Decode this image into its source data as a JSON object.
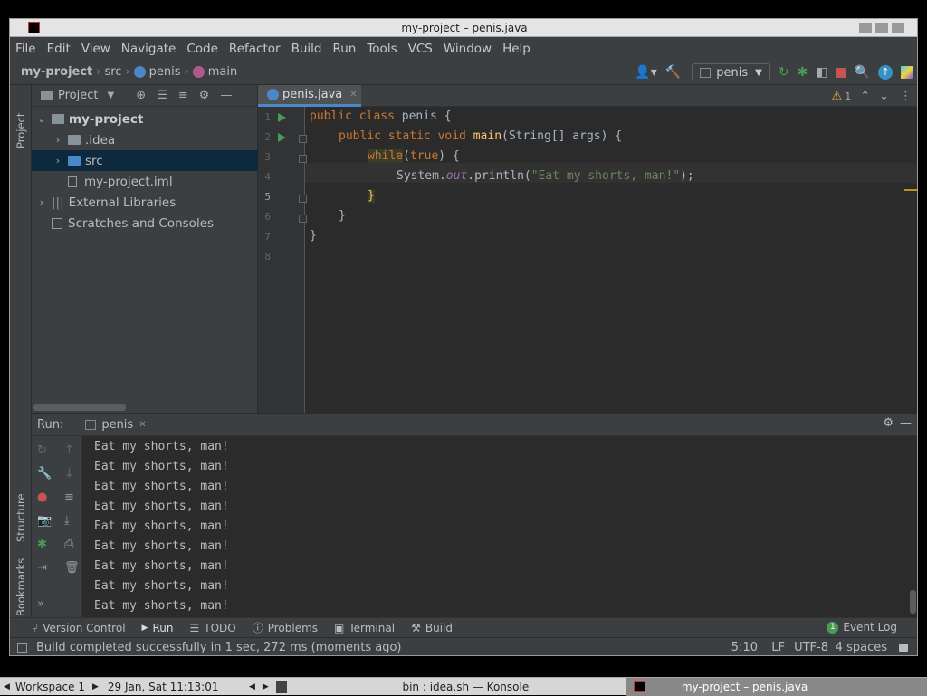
{
  "window": {
    "title": "my-project – penis.java"
  },
  "menu": [
    "File",
    "Edit",
    "View",
    "Navigate",
    "Code",
    "Refactor",
    "Build",
    "Run",
    "Tools",
    "VCS",
    "Window",
    "Help"
  ],
  "breadcrumb": {
    "project": "my-project",
    "src": "src",
    "class": "penis",
    "method": "main"
  },
  "toolbar": {
    "run_config": "penis"
  },
  "project_panel": {
    "title": "Project",
    "tree": {
      "root": "my-project",
      "idea": ".idea",
      "src": "src",
      "iml": "my-project.iml",
      "external": "External Libraries",
      "scratches": "Scratches and Consoles"
    }
  },
  "editor": {
    "tab": "penis.java",
    "warnings": "1",
    "lines": [
      "1",
      "2",
      "3",
      "4",
      "5",
      "6",
      "7",
      "8"
    ],
    "code": {
      "l1_kw": "public class ",
      "l1_name": "penis {",
      "l2_kw": "public static void ",
      "l2_fn": "main",
      "l2_rest": "(String[] args) {",
      "l3_kw": "while",
      "l3_p": "(",
      "l3_true": "true",
      "l3_rest": ") {",
      "l4_a": "System.",
      "l4_out": "out",
      "l4_b": ".println(",
      "l4_str": "\"Eat my shorts, man!\"",
      "l4_c": ");",
      "l5": "}",
      "l6": "}",
      "l7": "}"
    }
  },
  "run_panel": {
    "label": "Run:",
    "tab": "penis",
    "output": [
      "Eat my shorts, man!",
      "Eat my shorts, man!",
      "Eat my shorts, man!",
      "Eat my shorts, man!",
      "Eat my shorts, man!",
      "Eat my shorts, man!",
      "Eat my shorts, man!",
      "Eat my shorts, man!",
      "Eat my shorts, man!"
    ]
  },
  "side_labels": {
    "project": "Project",
    "structure": "Structure",
    "bookmarks": "Bookmarks"
  },
  "bottom_tabs": {
    "vcs": "Version Control",
    "run": "Run",
    "todo": "TODO",
    "problems": "Problems",
    "terminal": "Terminal",
    "build": "Build",
    "event_log": "Event Log",
    "event_count": "1"
  },
  "status": {
    "message": "Build completed successfully in 1 sec, 272 ms (moments ago)",
    "position": "5:10",
    "line_sep": "LF",
    "encoding": "UTF-8",
    "indent": "4 spaces"
  },
  "taskbar": {
    "workspace": "Workspace 1",
    "datetime": "29 Jan, Sat 11:13:01",
    "konsole": "bin : idea.sh — Konsole",
    "app": "my-project – penis.java"
  },
  "colors": {
    "keyword": "#cc7832",
    "function": "#ffc66d",
    "string": "#6a8759",
    "field": "#9876aa",
    "accent": "#4a88c7",
    "run_green": "#499c54"
  }
}
